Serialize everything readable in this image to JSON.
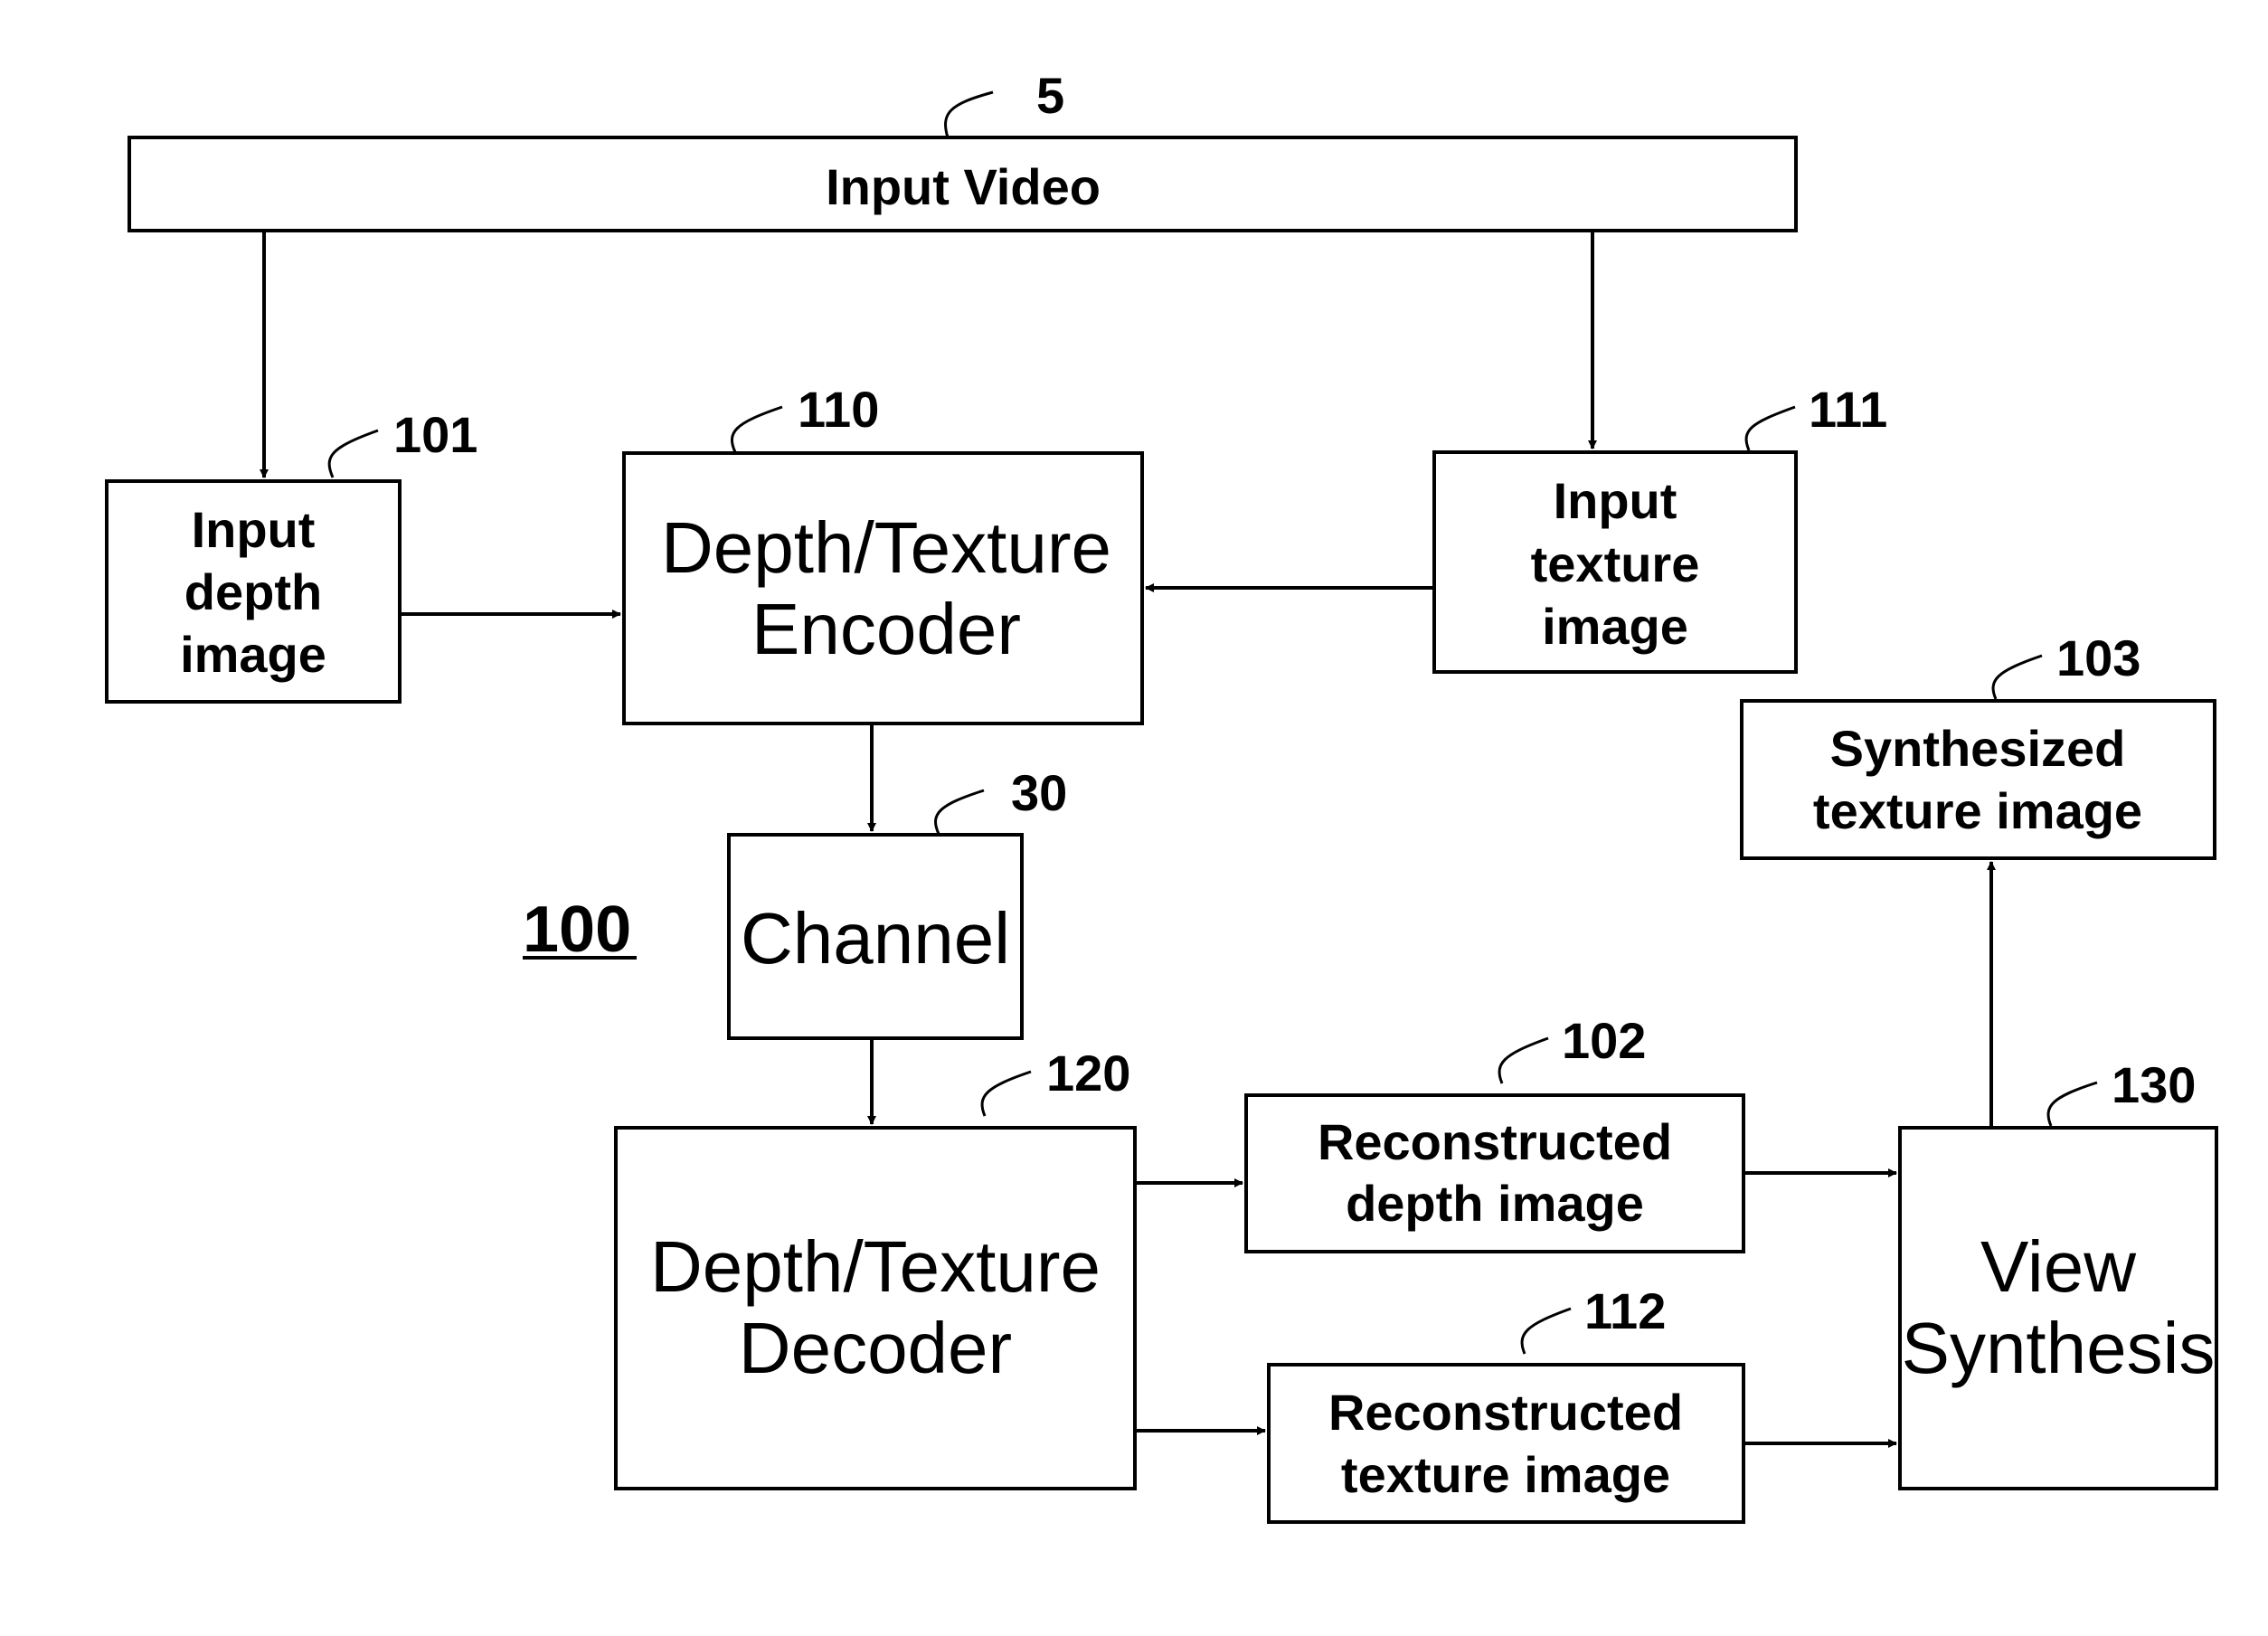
{
  "figure": {
    "number": "100"
  },
  "blocks": {
    "input_video": {
      "label": [
        "Input Video"
      ],
      "ref": "5"
    },
    "input_depth": {
      "label": [
        "Input",
        "depth",
        "image"
      ],
      "ref": "101"
    },
    "encoder": {
      "label": [
        "Depth/Texture",
        "Encoder"
      ],
      "ref": "110"
    },
    "input_texture": {
      "label": [
        "Input",
        "texture",
        "image"
      ],
      "ref": "111"
    },
    "synthesized": {
      "label": [
        "Synthesized",
        "texture image"
      ],
      "ref": "103"
    },
    "channel": {
      "label": [
        "Channel"
      ],
      "ref": "30"
    },
    "decoder": {
      "label": [
        "Depth/Texture",
        "Decoder"
      ],
      "ref": "120"
    },
    "recon_depth": {
      "label": [
        "Reconstructed",
        "depth image"
      ],
      "ref": "102"
    },
    "recon_texture": {
      "label": [
        "Reconstructed",
        "texture image"
      ],
      "ref": "112"
    },
    "view_synthesis": {
      "label": [
        "View",
        "Synthesis"
      ],
      "ref": "130"
    }
  },
  "connections": [
    {
      "from": "input_video",
      "to": "input_depth"
    },
    {
      "from": "input_video",
      "to": "input_texture"
    },
    {
      "from": "input_depth",
      "to": "encoder"
    },
    {
      "from": "input_texture",
      "to": "encoder"
    },
    {
      "from": "encoder",
      "to": "channel"
    },
    {
      "from": "channel",
      "to": "decoder"
    },
    {
      "from": "decoder",
      "to": "recon_depth"
    },
    {
      "from": "decoder",
      "to": "recon_texture"
    },
    {
      "from": "recon_depth",
      "to": "view_synthesis"
    },
    {
      "from": "recon_texture",
      "to": "view_synthesis"
    },
    {
      "from": "view_synthesis",
      "to": "synthesized"
    }
  ]
}
